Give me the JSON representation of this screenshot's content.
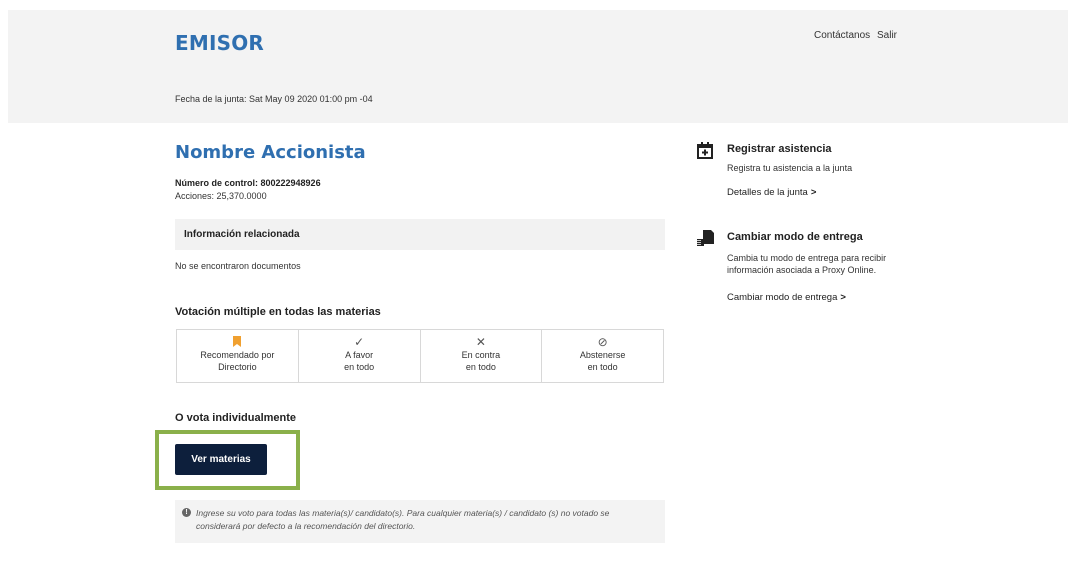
{
  "header": {
    "brand": "EMISOR",
    "contact_label": "Contáctanos",
    "logout_label": "Salir",
    "meeting_date": "Fecha de la junta: Sat May 09 2020 01:00 pm -04"
  },
  "holder": {
    "name": "Nombre Accionista",
    "control_number": "Número de control: 800222948926",
    "shares": "Acciones: 25,370.0000"
  },
  "related_info": {
    "title": "Información relacionada",
    "empty_text": "No se encontraron documentos"
  },
  "multi_vote": {
    "title": "Votación múltiple en todas las materias",
    "options": [
      {
        "icon": "bookmark-icon",
        "glyph": "",
        "line1": "Recomendado por",
        "line2": "Directorio",
        "color": "#f0a030"
      },
      {
        "icon": "check-icon",
        "glyph": "✓",
        "line1": "A favor",
        "line2": "en todo",
        "color": "#555555"
      },
      {
        "icon": "x-icon",
        "glyph": "✕",
        "line1": "En contra",
        "line2": "en todo",
        "color": "#555555"
      },
      {
        "icon": "ban-icon",
        "glyph": "⊘",
        "line1": "Abstenerse",
        "line2": "en todo",
        "color": "#555555"
      }
    ]
  },
  "individual": {
    "title": "O vota individualmente",
    "button_label": "Ver materias"
  },
  "note": {
    "text": "Ingrese su voto para todas las materia(s)/ candidato(s). Para cualquier materia(s) / candidato (s) no votado se considerará por defecto a la recomendación del directorio."
  },
  "sidebar": {
    "attendance": {
      "title": "Registrar asistencia",
      "desc": "Registra tu asistencia a la junta",
      "link": "Detalles de la junta"
    },
    "delivery": {
      "title": "Cambiar modo de entrega",
      "desc": "Cambia tu modo de entrega para recibir información asociada a Proxy Online.",
      "link": "Cambiar modo de entrega"
    }
  },
  "colors": {
    "brand_blue": "#2f6fb0",
    "button_navy": "#0d1f3c",
    "highlight_green": "#8ab04a",
    "header_bg": "#f3f3f3"
  }
}
